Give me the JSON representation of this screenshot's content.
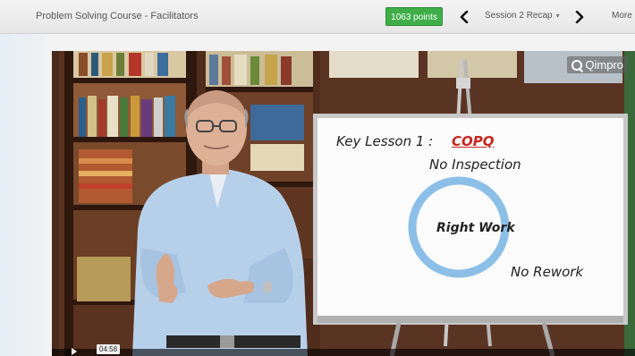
{
  "header": {
    "course_title": "Problem Solving Course - Facilitators",
    "points": "1063 points",
    "session_label": "Session 2 Recap",
    "session_caret": "▾",
    "more_label": "More"
  },
  "video": {
    "logo_text": "Qimpro",
    "timecode": "04:58",
    "whiteboard": {
      "key_lesson": "Key Lesson 1 :",
      "topic": "COPQ",
      "no_inspection": "No Inspection",
      "right_work": "Right Work",
      "no_rework": "No Rework"
    }
  },
  "colors": {
    "points_badge": "#3fae49",
    "copq_text": "#c7261d",
    "circle": "#8cbfe8"
  },
  "icons": {
    "prev": "chevron-left-icon",
    "next": "chevron-right-icon",
    "play": "play-icon",
    "logo": "qimpro-logo"
  }
}
